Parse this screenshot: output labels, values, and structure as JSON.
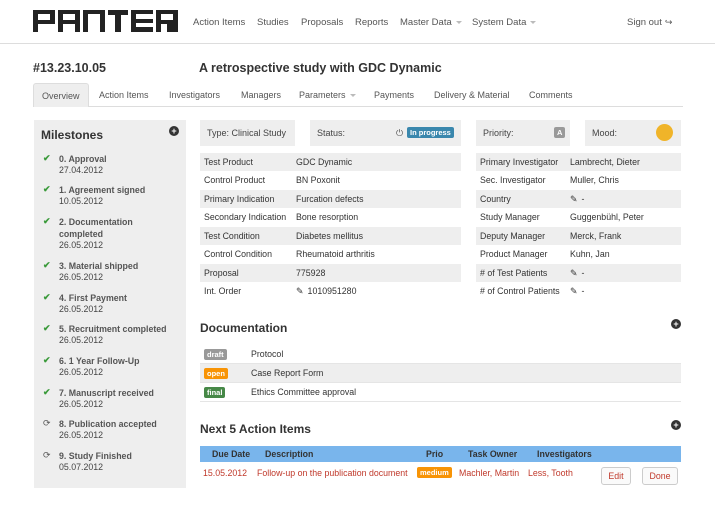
{
  "nav": {
    "logo": "PANTER",
    "items": [
      {
        "label": "Action Items"
      },
      {
        "label": "Studies"
      },
      {
        "label": "Proposals"
      },
      {
        "label": "Reports"
      },
      {
        "label": "Master Data"
      },
      {
        "label": "System Data"
      }
    ],
    "signout": "Sign out"
  },
  "study": {
    "id": "#13.23.10.05",
    "title": "A retrospective study with GDC Dynamic"
  },
  "tabs": [
    {
      "label": "Overview"
    },
    {
      "label": "Action Items"
    },
    {
      "label": "Investigators"
    },
    {
      "label": "Managers"
    },
    {
      "label": "Parameters"
    },
    {
      "label": "Payments"
    },
    {
      "label": "Delivery & Material"
    },
    {
      "label": "Comments"
    }
  ],
  "milestones": {
    "title": "Milestones",
    "items": [
      {
        "name": "0. Approval",
        "date": "27.04.2012",
        "icon": "check-icon"
      },
      {
        "name": "1. Agreement signed",
        "date": "10.05.2012",
        "icon": "check-icon"
      },
      {
        "name": "2. Documentation completed",
        "date": "26.05.2012",
        "icon": "check-icon"
      },
      {
        "name": "3. Material shipped",
        "date": "26.05.2012",
        "icon": "check-icon"
      },
      {
        "name": "4. First Payment",
        "date": "26.05.2012",
        "icon": "check-icon"
      },
      {
        "name": "5. Recruitment completed",
        "date": "26.05.2012",
        "icon": "check-icon"
      },
      {
        "name": "6. 1 Year Follow-Up",
        "date": "26.05.2012",
        "icon": "check-icon"
      },
      {
        "name": "7. Manuscript received",
        "date": "26.05.2012",
        "icon": "check-icon"
      },
      {
        "name": "8. Publication accepted",
        "date": "26.05.2012",
        "icon": "refresh-icon"
      },
      {
        "name": "9. Study Finished",
        "date": "05.07.2012",
        "icon": "refresh-icon"
      }
    ]
  },
  "status_bar": {
    "type_label": "Type:",
    "type_value": "Clinical Study",
    "status_label": "Status:",
    "status_value": "In progress",
    "priority_label": "Priority:",
    "priority_value": "A",
    "mood_label": "Mood:"
  },
  "info_left": [
    {
      "label": "Test Product",
      "value": "GDC Dynamic"
    },
    {
      "label": "Control Product",
      "value": "BN Poxonit"
    },
    {
      "label": "Primary Indication",
      "value": "Furcation defects"
    },
    {
      "label": "Secondary Indication",
      "value": "Bone resorption"
    },
    {
      "label": "Test Condition",
      "value": "Diabetes mellitus"
    },
    {
      "label": "Control Condition",
      "value": "Rheumatoid arthritis"
    },
    {
      "label": "Proposal",
      "value": "775928"
    },
    {
      "label": "Int. Order",
      "value": "1010951280"
    }
  ],
  "info_right": [
    {
      "label": "Primary Investigator",
      "value": "Lambrecht, Dieter"
    },
    {
      "label": "Sec. Investigator",
      "value": "Muller, Chris"
    },
    {
      "label": "Country",
      "value": "-"
    },
    {
      "label": "Study Manager",
      "value": "Guggenbühl, Peter"
    },
    {
      "label": "Deputy Manager",
      "value": "Merck, Frank"
    },
    {
      "label": "Product Manager",
      "value": "Kuhn, Jan"
    },
    {
      "label": "# of Test Patients",
      "value": "-"
    },
    {
      "label": "# of Control Patients",
      "value": "-"
    }
  ],
  "documentation": {
    "title": "Documentation",
    "items": [
      {
        "status": "draft",
        "name": "Protocol",
        "color": "#999999"
      },
      {
        "status": "open",
        "name": "Case Report Form",
        "color": "#f89406"
      },
      {
        "status": "final",
        "name": "Ethics Committee approval",
        "color": "#468847"
      }
    ]
  },
  "actions": {
    "title": "Next 5 Action Items",
    "headers": {
      "due": "Due Date",
      "desc": "Description",
      "prio": "Prio",
      "owner": "Task Owner",
      "inv": "Investigators"
    },
    "rows": [
      {
        "due": "15.05.2012",
        "desc": "Follow-up on the publication document",
        "prio": "medium",
        "owner": "Machler, Martin",
        "inv": "Less, Tooth",
        "edit": "Edit",
        "done": "Done"
      }
    ]
  },
  "colors": {
    "accent": "#79b5ec",
    "status_blue": "#3a87ad",
    "done_green": "#3a9a3a",
    "prio_orange": "#f89406",
    "link_red": "#c0392b"
  }
}
